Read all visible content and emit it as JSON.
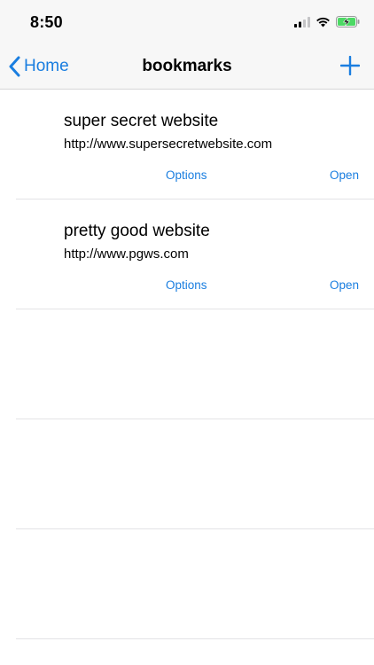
{
  "status_bar": {
    "time": "8:50",
    "icons": [
      "cellular-signal-icon",
      "wifi-icon",
      "battery-charging-icon"
    ]
  },
  "nav": {
    "back_label": "Home",
    "title": "bookmarks",
    "add_icon": "plus-icon"
  },
  "bookmarks": [
    {
      "title": "super secret website",
      "url": "http://www.supersecretwebsite.com",
      "options_label": "Options",
      "open_label": "Open"
    },
    {
      "title": "pretty good website",
      "url": "http://www.pgws.com",
      "options_label": "Options",
      "open_label": "Open"
    }
  ],
  "colors": {
    "accent": "#1a7ee0",
    "bar_background": "#f7f7f7",
    "separator": "#e3e3e6",
    "battery_green": "#4cd964"
  }
}
